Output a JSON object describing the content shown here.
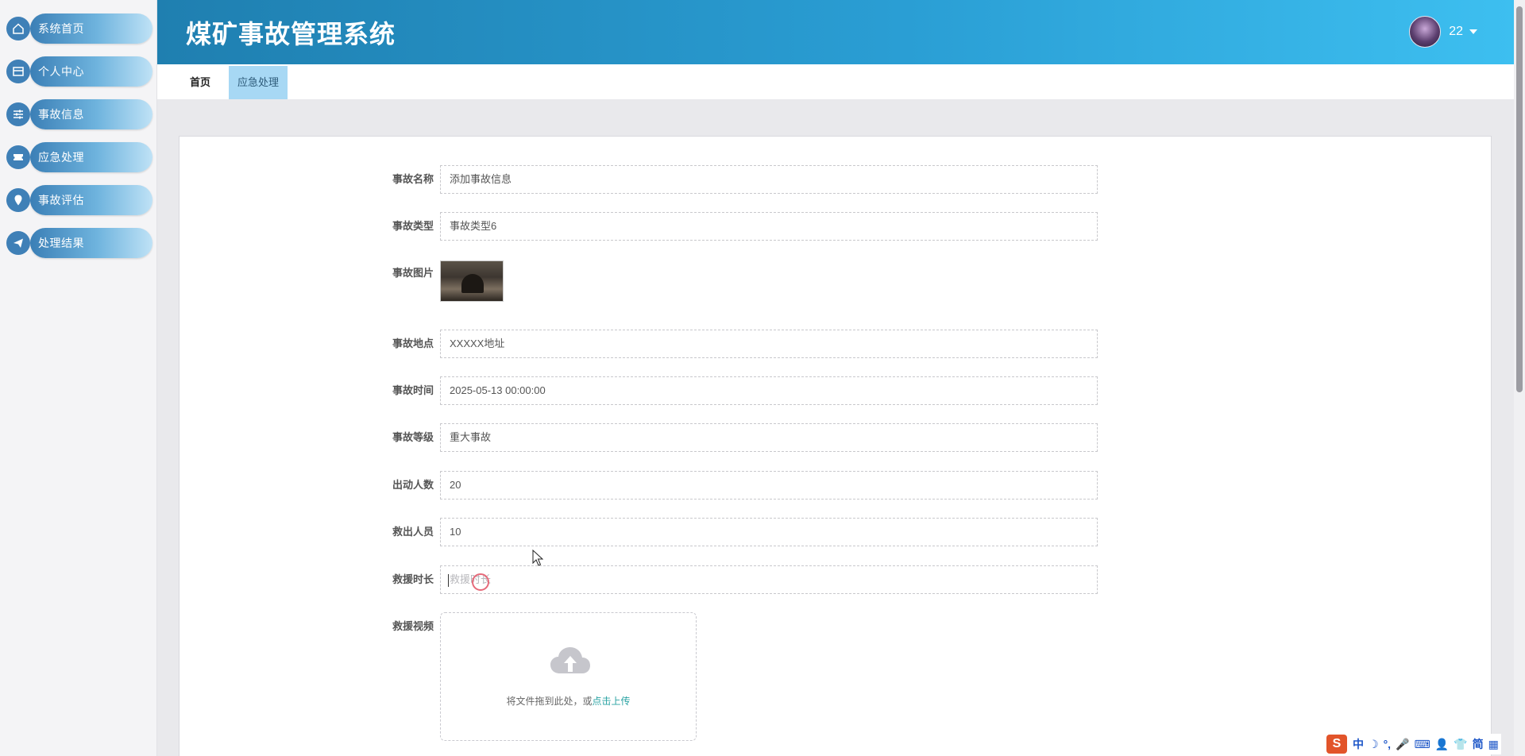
{
  "app": {
    "title": "煤矿事故管理系统"
  },
  "user": {
    "name": "22"
  },
  "sidebar": {
    "items": [
      {
        "label": "系统首页",
        "icon": "home-icon"
      },
      {
        "label": "个人中心",
        "icon": "profile-card-icon"
      },
      {
        "label": "事故信息",
        "icon": "sliders-icon"
      },
      {
        "label": "应急处理",
        "icon": "ticket-icon"
      },
      {
        "label": "事故评估",
        "icon": "location-pin-icon"
      },
      {
        "label": "处理结果",
        "icon": "paper-plane-icon"
      }
    ]
  },
  "tabs": {
    "home": "首页",
    "active": "应急处理"
  },
  "form": {
    "accident_name": {
      "label": "事故名称",
      "value": "添加事故信息"
    },
    "accident_type": {
      "label": "事故类型",
      "value": "事故类型6"
    },
    "accident_image": {
      "label": "事故图片"
    },
    "accident_location": {
      "label": "事故地点",
      "value": "XXXXX地址"
    },
    "accident_time": {
      "label": "事故时间",
      "value": "2025-05-13 00:00:00"
    },
    "accident_level": {
      "label": "事故等级",
      "value": "重大事故"
    },
    "dispatched_count": {
      "label": "出动人数",
      "value": "20"
    },
    "rescued_count": {
      "label": "救出人员",
      "value": "10"
    },
    "rescue_duration": {
      "label": "救援时长",
      "placeholder": "救援时长"
    },
    "rescue_video": {
      "label": "救援视频",
      "drop_text": "将文件拖到此处，或",
      "link_text": "点击上传"
    }
  },
  "ime": {
    "logo": "S",
    "items": [
      "中",
      "☽",
      "°,",
      "🎤",
      "⌨",
      "👤",
      "👕",
      "简",
      "▦"
    ]
  },
  "colors": {
    "header_start": "#1f7fb0",
    "header_end": "#3dbff0",
    "tab_active_bg": "#a7d8f4",
    "upload_link": "#2ba3a3"
  }
}
